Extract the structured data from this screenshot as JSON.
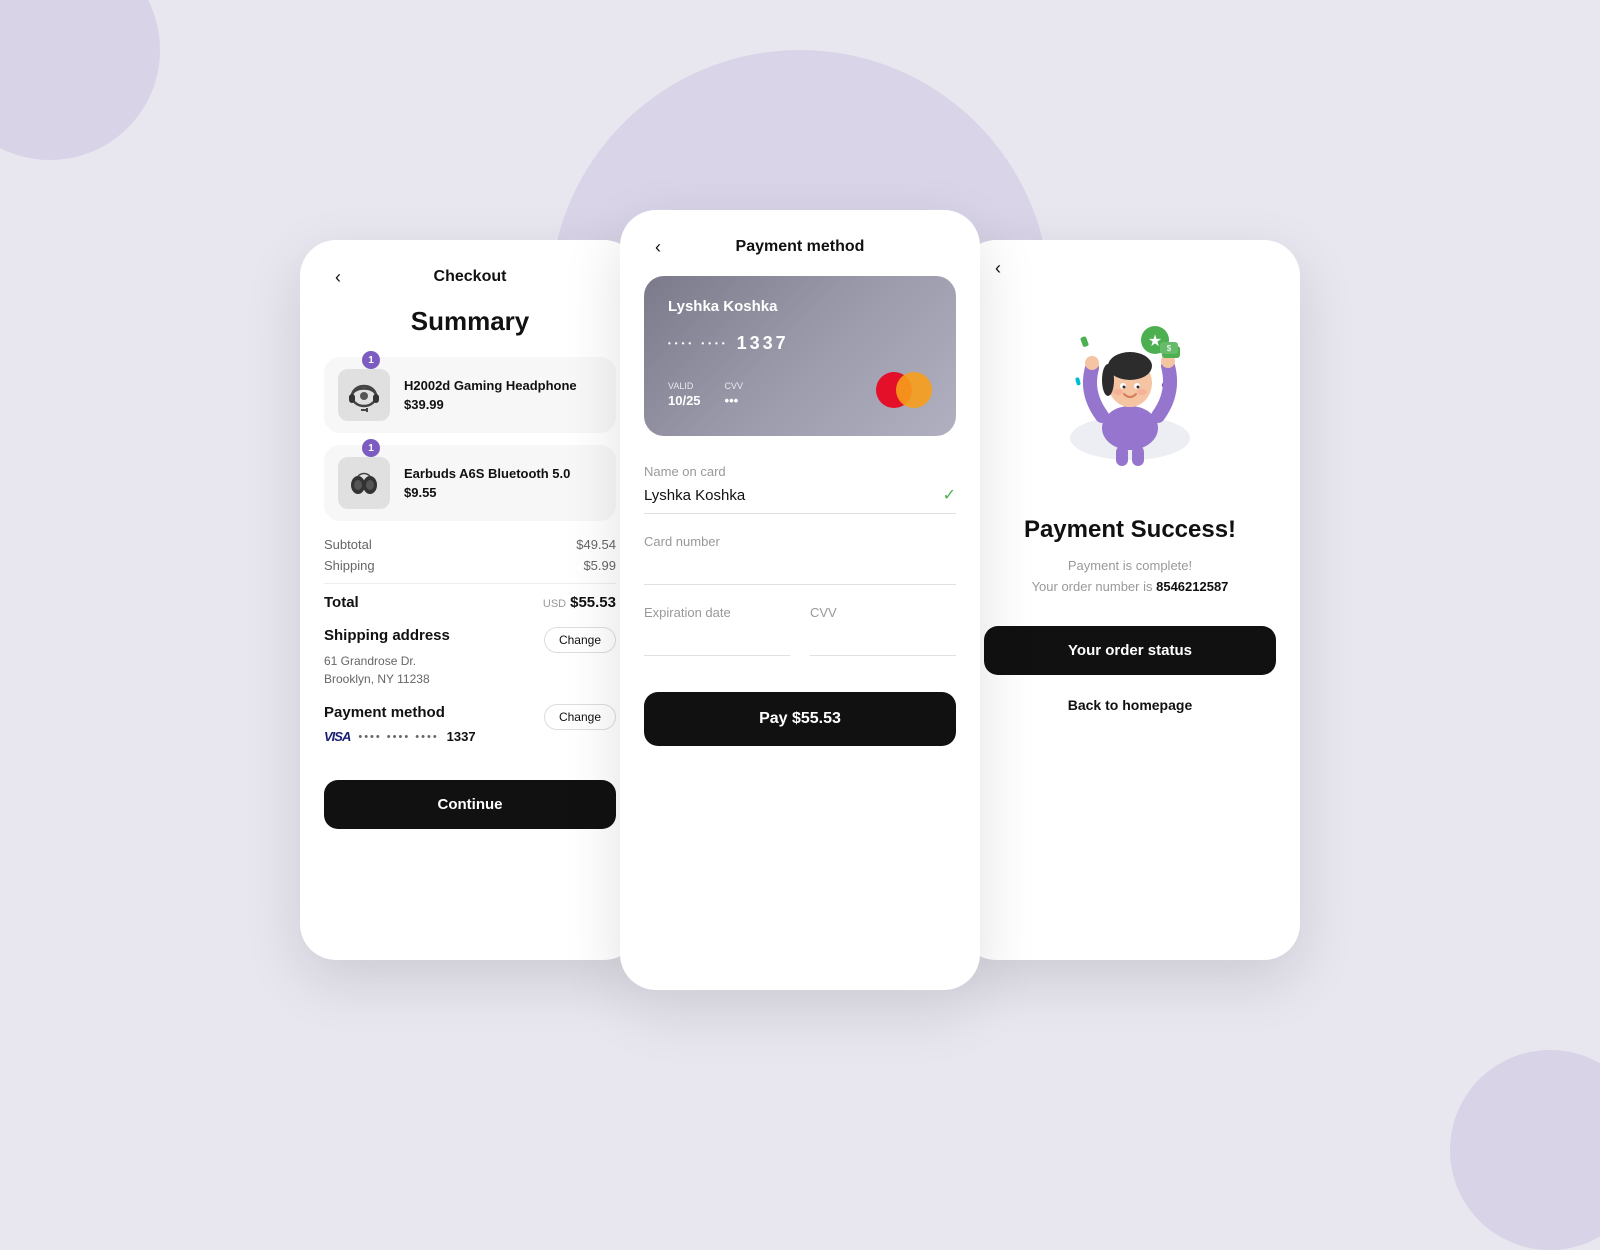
{
  "background": {
    "color": "#e8e6ef",
    "blob_color": "#c9bfe0"
  },
  "checkout": {
    "back_label": "‹",
    "title": "Checkout",
    "summary_title": "Summary",
    "products": [
      {
        "name": "H2002d Gaming Headphone",
        "price": "$39.99",
        "badge": "1",
        "icon": "headphone"
      },
      {
        "name": "Earbuds A6S Bluetooth 5.0",
        "price": "$9.55",
        "badge": "1",
        "icon": "earbuds"
      }
    ],
    "subtotal_label": "Subtotal",
    "subtotal_value": "$49.54",
    "shipping_label": "Shipping",
    "shipping_value": "$5.99",
    "total_label": "Total",
    "total_currency": "USD",
    "total_value": "$55.53",
    "shipping_address_label": "Shipping address",
    "address_line1": "61 Grandrose Dr.",
    "address_line2": "Brooklyn, NY 11238",
    "change_label": "Change",
    "payment_method_label": "Payment method",
    "card_dots": "•••• •••• ••••",
    "card_last4": "1337",
    "change2_label": "Change",
    "continue_label": "Continue"
  },
  "payment": {
    "back_label": "‹",
    "title": "Payment method",
    "card": {
      "cardholder": "Lyshka Koshka",
      "number_dots": "•••• ••••",
      "number_last": "1337",
      "valid_label": "VALID",
      "valid_value": "10/25",
      "cvv_label": "CVV",
      "cvv_dots": "•••"
    },
    "form": {
      "name_label": "Name on card",
      "name_value": "Lyshka Koshka",
      "card_number_label": "Card number",
      "card_number_value": "",
      "expiry_label": "Expiration date",
      "expiry_value": "",
      "cvv_label": "CVV",
      "cvv_value": ""
    },
    "pay_label": "Pay $55.53"
  },
  "success": {
    "back_label": "‹",
    "title": "Payment Success!",
    "message_line1": "Payment is complete!",
    "message_line2": "Your order number is",
    "order_number": "8546212587",
    "order_status_label": "Your order status",
    "homepage_label": "Back to homepage"
  }
}
